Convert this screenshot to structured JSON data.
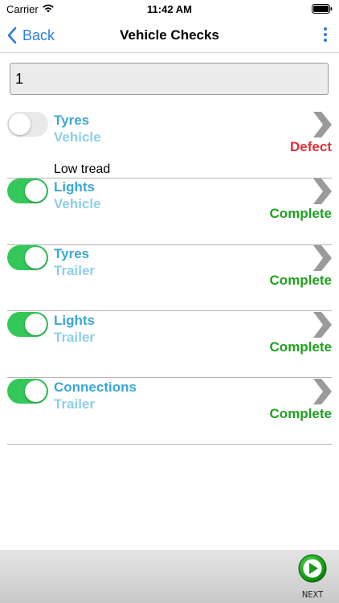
{
  "status_bar": {
    "carrier": "Carrier",
    "time": "11:42 AM"
  },
  "nav": {
    "back_label": "Back",
    "title": "Vehicle Checks"
  },
  "input": {
    "value": "1"
  },
  "checks": [
    {
      "title": "Tyres",
      "subtitle": "Vehicle",
      "status": "Defect",
      "enabled": false,
      "note": "Low tread"
    },
    {
      "title": "Lights",
      "subtitle": "Vehicle",
      "status": "Complete",
      "enabled": true
    },
    {
      "title": "Tyres",
      "subtitle": "Trailer",
      "status": "Complete",
      "enabled": true
    },
    {
      "title": "Lights",
      "subtitle": "Trailer",
      "status": "Complete",
      "enabled": true
    },
    {
      "title": "Connections",
      "subtitle": "Trailer",
      "status": "Complete",
      "enabled": true
    }
  ],
  "footer": {
    "next_label": "NEXT"
  },
  "colors": {
    "accent": "#2a7de1",
    "toggle_on": "#34c759",
    "complete": "#20a020",
    "defect": "#e0303a",
    "title": "#3aa7d8",
    "subtitle": "#8fcfe6"
  }
}
